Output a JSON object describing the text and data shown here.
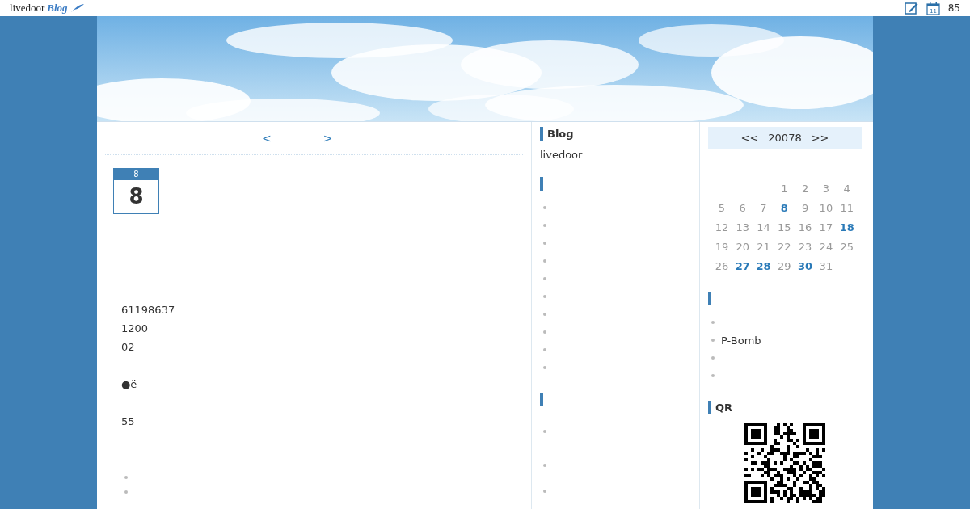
{
  "topbar": {
    "logo_text": "livedoor",
    "logo_script": "Blog",
    "calendar_icon_day": "11",
    "count": "85"
  },
  "main": {
    "nav": {
      "prev": "<",
      "next": ">"
    },
    "date_badge": {
      "month": "8",
      "day": "8"
    },
    "body_lines": [
      {
        "text": "61198637"
      },
      {
        "text": "1200"
      },
      {
        "text": "02",
        "gap_after": true
      },
      {
        "text": "●ë",
        "gap_after": true
      },
      {
        "text": "55"
      }
    ],
    "footer_items": [
      {
        "kind": "empty"
      },
      {
        "kind": "empty"
      }
    ]
  },
  "middle_sidebar": [
    {
      "title": "Blog",
      "text": "livedoor"
    },
    {
      "items": [
        {
          "kind": "empty"
        },
        {
          "kind": "empty"
        },
        {
          "kind": "empty"
        },
        {
          "kind": "empty"
        },
        {
          "kind": "empty"
        },
        {
          "kind": "empty"
        },
        {
          "kind": "empty"
        },
        {
          "kind": "empty"
        },
        {
          "kind": "empty"
        },
        {
          "kind": "empty"
        }
      ]
    },
    {
      "items": [
        {
          "kind": "tall"
        },
        {
          "kind": "tall"
        },
        {
          "kind": "empty"
        }
      ]
    }
  ],
  "calendar": {
    "prev": "<<",
    "month": "20078",
    "next": ">>",
    "weeks": [
      {
        "days": [
          {
            "day": "1",
            "linked": false
          },
          {
            "day": "2",
            "linked": false
          },
          {
            "day": "3",
            "linked": false
          },
          {
            "day": "4",
            "linked": false
          }
        ]
      },
      {
        "days": [
          {
            "day": "5",
            "linked": false
          },
          {
            "day": "6",
            "linked": false
          },
          {
            "day": "7",
            "linked": false
          },
          {
            "day": "8",
            "linked": true
          },
          {
            "day": "9",
            "linked": false
          },
          {
            "day": "10",
            "linked": false
          },
          {
            "day": "11",
            "linked": false
          }
        ]
      },
      {
        "days": [
          {
            "day": "12",
            "linked": false
          },
          {
            "day": "13",
            "linked": false
          },
          {
            "day": "14",
            "linked": false
          },
          {
            "day": "15",
            "linked": false
          },
          {
            "day": "16",
            "linked": false
          },
          {
            "day": "17",
            "linked": false
          },
          {
            "day": "18",
            "linked": true
          }
        ]
      },
      {
        "days": [
          {
            "day": "19",
            "linked": false
          },
          {
            "day": "20",
            "linked": false
          },
          {
            "day": "21",
            "linked": false
          },
          {
            "day": "22",
            "linked": false
          },
          {
            "day": "23",
            "linked": false
          },
          {
            "day": "24",
            "linked": false
          },
          {
            "day": "25",
            "linked": false
          }
        ]
      },
      {
        "days": [
          {
            "day": "26",
            "linked": false
          },
          {
            "day": "27",
            "linked": true
          },
          {
            "day": "28",
            "linked": true
          },
          {
            "day": "29",
            "linked": false
          },
          {
            "day": "30",
            "linked": true
          },
          {
            "day": "31",
            "linked": false
          }
        ]
      }
    ]
  },
  "right_sidebar": [
    {
      "items": [
        {
          "kind": "empty"
        },
        {
          "kind": "text",
          "text": "P-Bomb"
        },
        {
          "kind": "empty"
        },
        {
          "kind": "empty"
        }
      ]
    },
    {
      "title": "QR",
      "kind": "qr"
    }
  ]
}
